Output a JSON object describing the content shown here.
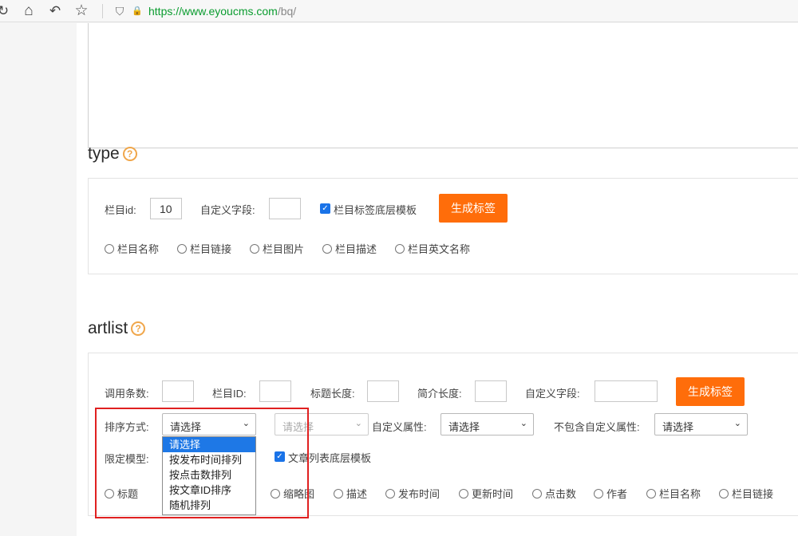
{
  "browser": {
    "url_host": "https://www.eyoucms.com",
    "url_path": "/bq/",
    "reload_glyph": "↻",
    "home_glyph": "⌂",
    "back_glyph": "↶",
    "star_glyph": "☆",
    "shield_glyph": "⛉",
    "lock_glyph": "🔒"
  },
  "type_section": {
    "title": "type",
    "help_glyph": "?",
    "cat_id_label": "栏目id:",
    "cat_id_value": "10",
    "custom_field_label": "自定义字段:",
    "custom_field_value": "",
    "checkbox_label": "栏目标签底层模板",
    "generate_button": "生成标签",
    "radios": [
      "栏目名称",
      "栏目链接",
      "栏目图片",
      "栏目描述",
      "栏目英文名称"
    ]
  },
  "artlist_section": {
    "title": "artlist",
    "help_glyph": "?",
    "count_label": "调用条数:",
    "cat_id_label": "栏目ID:",
    "title_len_label": "标题长度:",
    "intro_len_label": "简介长度:",
    "custom_field_label": "自定义字段:",
    "generate_button": "生成标签",
    "sort_label": "排序方式:",
    "sort_select_value": "请选择",
    "second_select_placeholder": "请选择",
    "custom_attr_label": "自定义属性:",
    "custom_attr_value": "请选择",
    "exclude_attr_label": "不包含自定义属性:",
    "exclude_attr_value": "请选择",
    "model_label": "限定模型:",
    "checkbox_label": "文章列表底层模板",
    "radios": [
      "标题",
      "缩略图",
      "描述",
      "发布时间",
      "更新时间",
      "点击数",
      "作者",
      "栏目名称",
      "栏目链接"
    ],
    "sort_options": [
      "请选择",
      "按发布时间排列",
      "按点击数排列",
      "按文章ID排序",
      "随机排列"
    ],
    "sort_options_active_index": 0
  },
  "colors": {
    "accent": "#ff6d0a",
    "url_green": "#0a9c2f",
    "highlight_red": "#e02020",
    "option_blue": "#1e78e6"
  }
}
